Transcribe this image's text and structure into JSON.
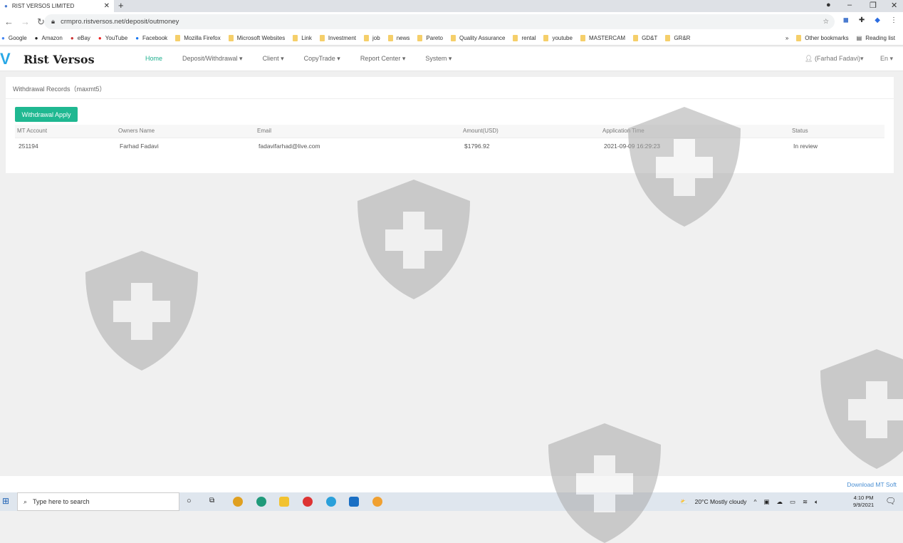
{
  "browser": {
    "tab_title": "RIST VERSOS LIMITED",
    "url": "crmpro.ristversos.net/deposit/outmoney",
    "bookmarks": [
      "Google",
      "Amazon",
      "eBay",
      "YouTube",
      "Facebook",
      "Mozilla Firefox",
      "Microsoft Websites",
      "Link",
      "Investment",
      "job",
      "news",
      "Pareto",
      "Quality Assurance",
      "rental",
      "youtube",
      "MASTERCAM",
      "GD&T",
      "GR&R"
    ],
    "other_bookmarks": "Other bookmarks",
    "reading_list": "Reading list",
    "overflow": "»"
  },
  "site": {
    "brand": "Rist Versos",
    "nav": [
      "Home",
      "Deposit/Withdrawal ▾",
      "Client ▾",
      "CopyTrade ▾",
      "Report Center ▾",
      "System ▾"
    ],
    "user": "(Farhad Fadavi)▾",
    "lang": "En ▾"
  },
  "page": {
    "title": "Withdrawal Records（maxmt5）",
    "apply_button": "Withdrawal Apply",
    "columns": [
      "MT Account",
      "Owners Name",
      "Email",
      "Amount(USD)",
      "Application Time",
      "Status"
    ],
    "rows": [
      [
        "251194",
        "Farhad Fadavi",
        "fadavifarhad@live.com",
        "$1796.92",
        "2021-09-09 16:29:23",
        "In review"
      ]
    ]
  },
  "footer": {
    "download": "Download MT Soft"
  },
  "taskbar": {
    "search_placeholder": "Type here to search",
    "weather": "20°C  Mostly cloudy",
    "time": "4:10 PM",
    "date": "9/9/2021"
  },
  "colors": {
    "accent": "#1fb891",
    "link": "#4a8fd3"
  }
}
